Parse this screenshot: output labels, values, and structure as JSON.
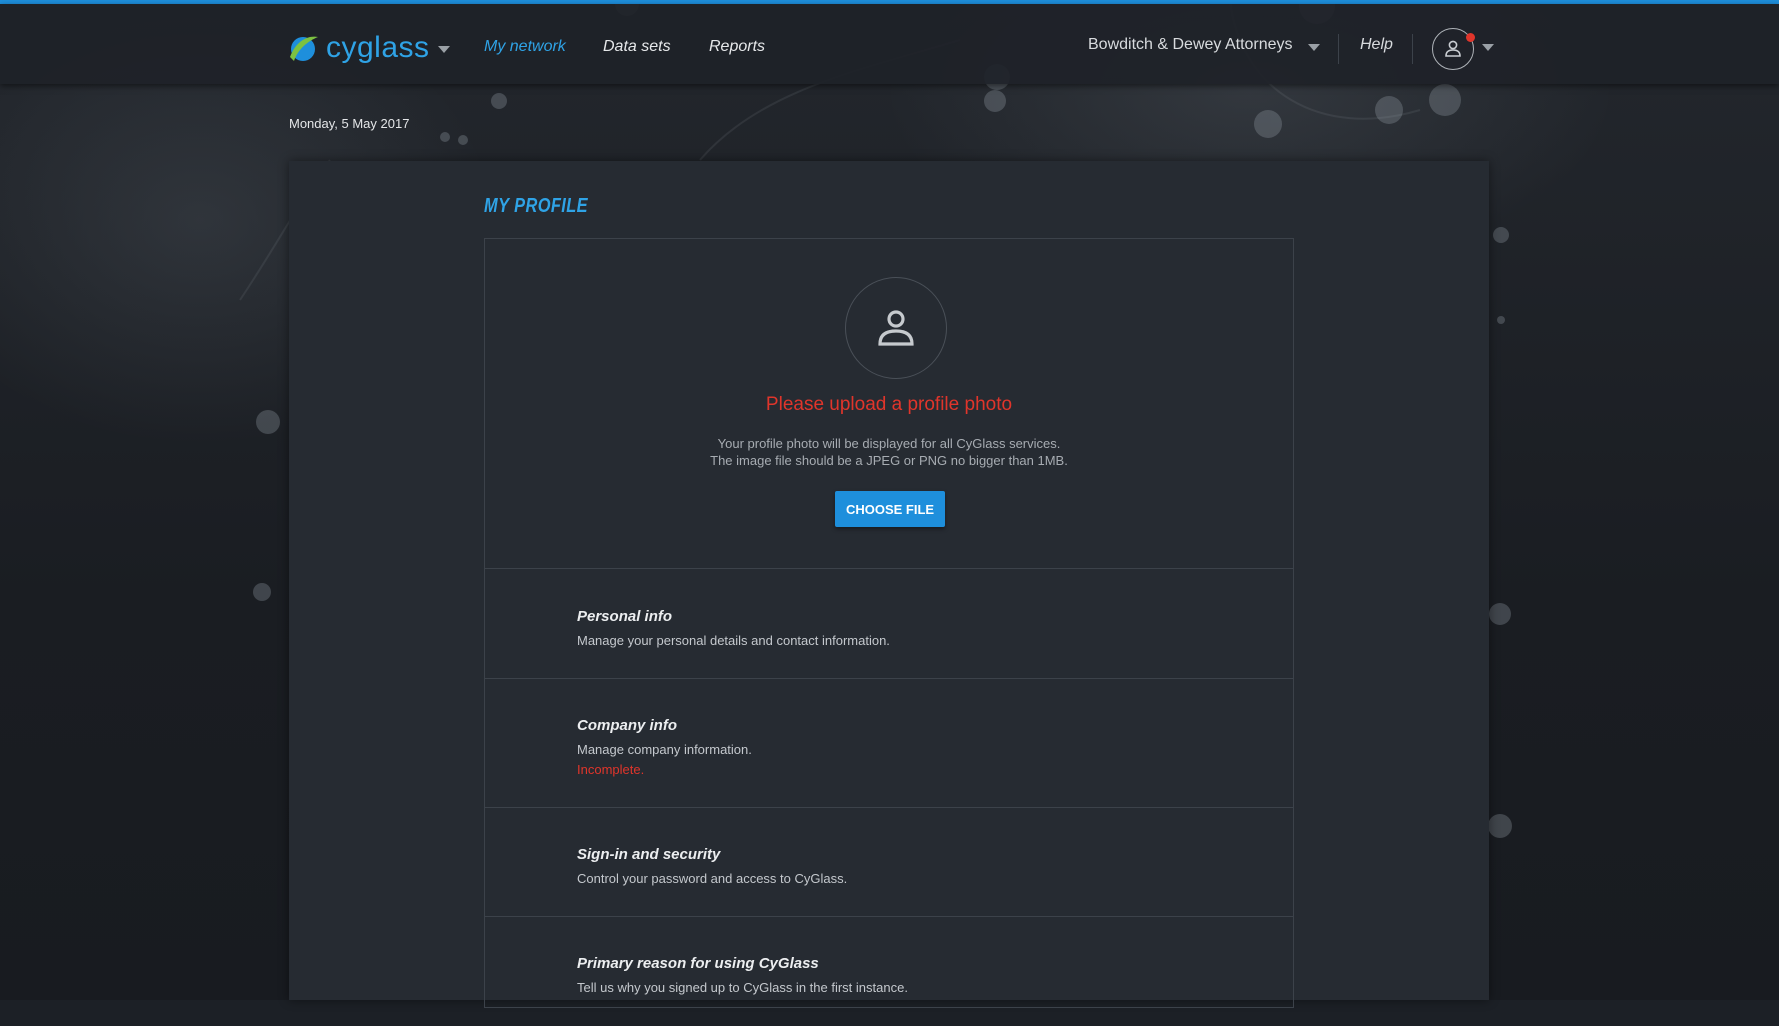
{
  "app": {
    "logo_text": "cyglass",
    "accent_color": "#1e8fdc",
    "error_color": "#e0352b"
  },
  "nav": {
    "links": [
      {
        "label": "My network",
        "active": true
      },
      {
        "label": "Data sets",
        "active": false
      },
      {
        "label": "Reports",
        "active": false
      }
    ],
    "organization": "Bowditch & Dewey Attorneys",
    "help": "Help",
    "avatar_icon": "user-icon"
  },
  "date": "Monday, 5 May 2017",
  "page": {
    "title": "MY PROFILE"
  },
  "photo": {
    "title": "Please upload a profile photo",
    "desc_line1": "Your profile photo will be displayed for all CyGlass services.",
    "desc_line2": "The image file should be a JPEG or PNG no bigger than 1MB.",
    "button": "CHOOSE FILE"
  },
  "sections": [
    {
      "title": "Personal info",
      "desc": "Manage your personal details and contact information.",
      "status": ""
    },
    {
      "title": "Company info",
      "desc": "Manage company information.",
      "status": "Incomplete."
    },
    {
      "title": "Sign-in and security",
      "desc": "Control your password and access to CyGlass.",
      "status": ""
    },
    {
      "title": "Primary reason for using CyGlass",
      "desc": "Tell us why you signed up to CyGlass in the first instance.",
      "status": ""
    }
  ]
}
